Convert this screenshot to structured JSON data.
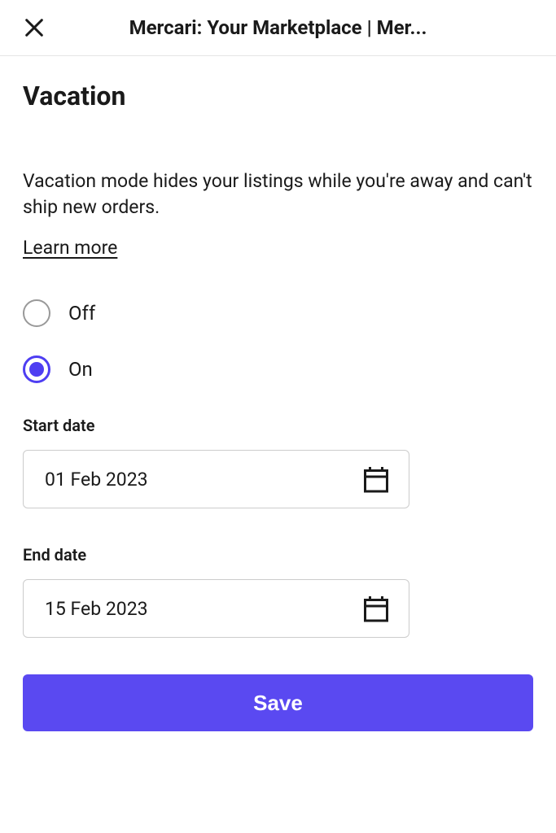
{
  "header": {
    "title": "Mercari: Your Marketplace | Mer..."
  },
  "page": {
    "title": "Vacation",
    "description": "Vacation mode hides your listings while you're away and can't ship new orders.",
    "learn_more": "Learn more"
  },
  "radio": {
    "off_label": "Off",
    "on_label": "On",
    "selected": "on"
  },
  "start_date": {
    "label": "Start date",
    "value": "01 Feb 2023"
  },
  "end_date": {
    "label": "End date",
    "value": "15 Feb 2023"
  },
  "save_button_label": "Save"
}
